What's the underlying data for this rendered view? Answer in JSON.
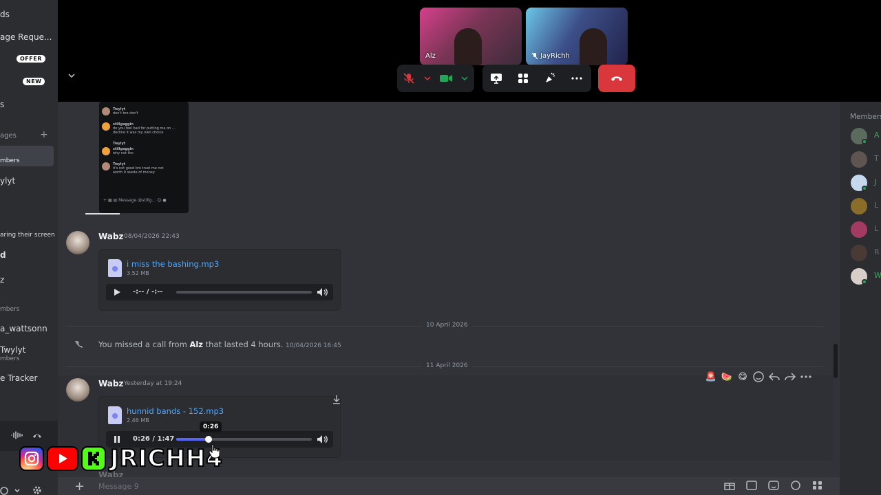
{
  "sidebar": {
    "items": [
      {
        "label": "ds"
      },
      {
        "label": "age Reque..."
      },
      {
        "badge": "OFFER"
      },
      {
        "badge": "NEW"
      },
      {
        "label": "s"
      },
      {
        "label": "ages"
      },
      {
        "label": "mbers"
      },
      {
        "label": "ylyt"
      },
      {
        "label": "aring their screen"
      },
      {
        "label": "d"
      },
      {
        "label": "z"
      },
      {
        "label": "mbers"
      },
      {
        "label": "a_wattsonn"
      },
      {
        "label": "Twylyt"
      },
      {
        "label": "mbers"
      },
      {
        "label": "e Tracker"
      }
    ]
  },
  "call": {
    "participants": [
      {
        "name": "Alz",
        "muted": false
      },
      {
        "name": "JayRichh",
        "muted": true
      }
    ],
    "controls": [
      "mic-muted",
      "camera",
      "screen-share",
      "activities",
      "soundboard",
      "more"
    ],
    "colors": {
      "end_call": "#da373c",
      "muted_red": "#da373c",
      "camera_green": "#23a55a"
    }
  },
  "chat": {
    "embed_preview": {
      "lines": [
        {
          "user": "Twylyt",
          "text": "don't bro don't"
        },
        {
          "user": "stillgaggin",
          "text": "do you feel bad for putting me on ... decline it was my own choice"
        },
        {
          "user": "Twylyt",
          "text": ""
        },
        {
          "user": "stillgaggin",
          "text": "why not tho"
        },
        {
          "user": "Twylyt",
          "text": "it's not good bro trust me not worth it waste of money"
        }
      ],
      "composer_placeholder": "Message @stillg..."
    },
    "messages": [
      {
        "username": "Wabz",
        "timestamp": "08/04/2026 22:43",
        "file_name": "i miss the bashing.mp3",
        "file_size": "3.52 MB",
        "time": "-:-- / -:--",
        "progress": 0.0
      },
      {
        "username": "Wabz",
        "timestamp": "Yesterday at 19:24",
        "file_name": "hunnid bands - 152.mp3",
        "file_size": "2.46 MB",
        "time": "0:26 / 1:47",
        "progress": 0.24,
        "tooltip": "0:26"
      }
    ],
    "divider_1": "10 April 2026",
    "divider_2": "11 April 2026",
    "missed_call": {
      "prefix": "You missed a call from ",
      "caller": "Alz",
      "suffix": " that lasted 4 hours.",
      "timestamp": "10/04/2026 16:45"
    },
    "ghost_username": "Wabz",
    "reactions": [
      "🚨",
      "🍉",
      "😋"
    ],
    "composer": {
      "placeholder": "Message 9"
    }
  },
  "members": {
    "title": "Members",
    "list": [
      {
        "initial": "A",
        "color": "#3ba55d",
        "online": true
      },
      {
        "initial": "T",
        "color": "#6d6f78",
        "online": false
      },
      {
        "initial": "J",
        "color": "#3ba55d",
        "online": true
      },
      {
        "initial": "L",
        "color": "#6d6f78",
        "online": false
      },
      {
        "initial": "L",
        "color": "#6d6f78",
        "online": false
      },
      {
        "initial": "R",
        "color": "#6d6f78",
        "online": false
      },
      {
        "initial": "W",
        "color": "#3ba55d",
        "online": true
      }
    ]
  },
  "overlay": {
    "brand": "JRICHH4",
    "socials": [
      "instagram-icon",
      "youtube-icon",
      "kick-icon"
    ]
  }
}
